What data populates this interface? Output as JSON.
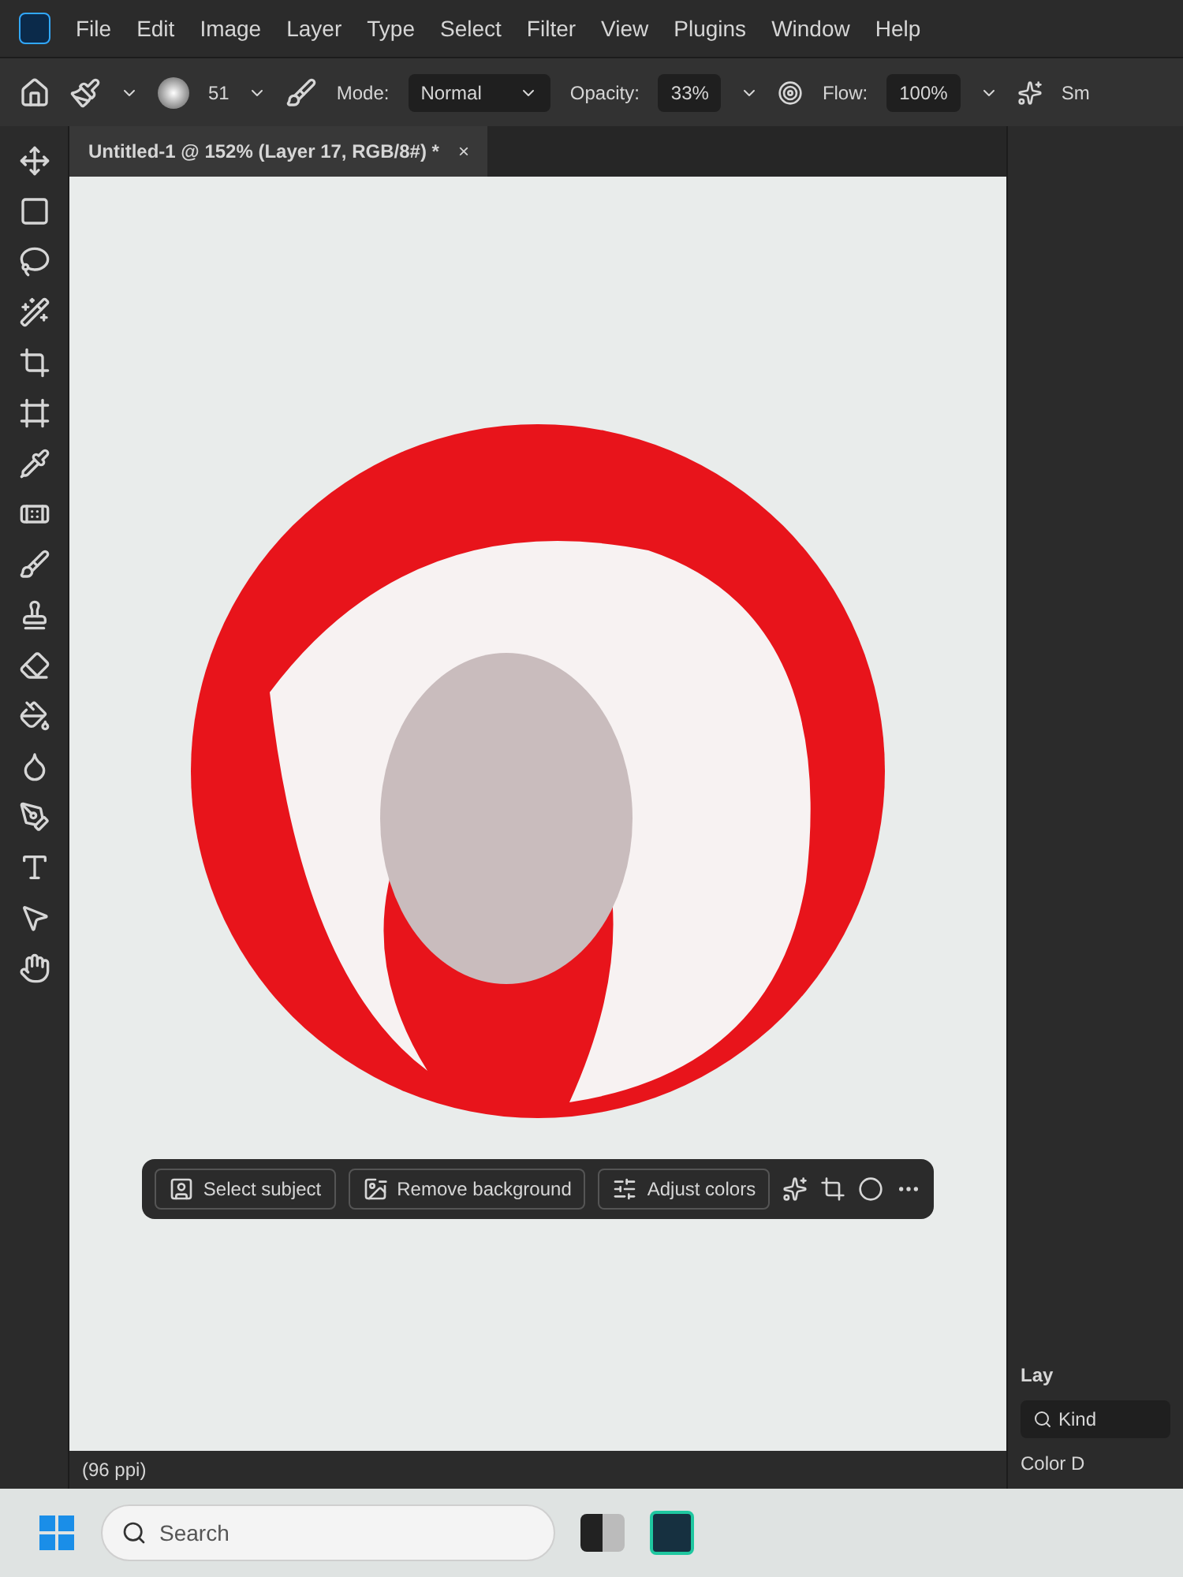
{
  "menu": [
    "File",
    "Edit",
    "Image",
    "Layer",
    "Type",
    "Select",
    "Filter",
    "View",
    "Plugins",
    "Window",
    "Help"
  ],
  "options_bar": {
    "brush_size": "51",
    "mode_label": "Mode:",
    "mode": "Normal",
    "opacity_label": "Opacity:",
    "opacity": "33%",
    "flow_label": "Flow:",
    "flow": "100%",
    "cut_label": "Sm"
  },
  "document_tab": {
    "title": "Untitled-1 @ 152% (Layer 17, RGB/8#) *",
    "close": "×"
  },
  "contextual_bar": {
    "buttons": [
      "Select subject",
      "Remove background",
      "Adjust colors"
    ]
  },
  "status_bar": {
    "resolution": "(96 ppi)"
  },
  "layers_panel": {
    "title": "Lay",
    "filter": "Kind",
    "row": "Color D"
  },
  "taskbar": {
    "search_placeholder": "Search"
  }
}
